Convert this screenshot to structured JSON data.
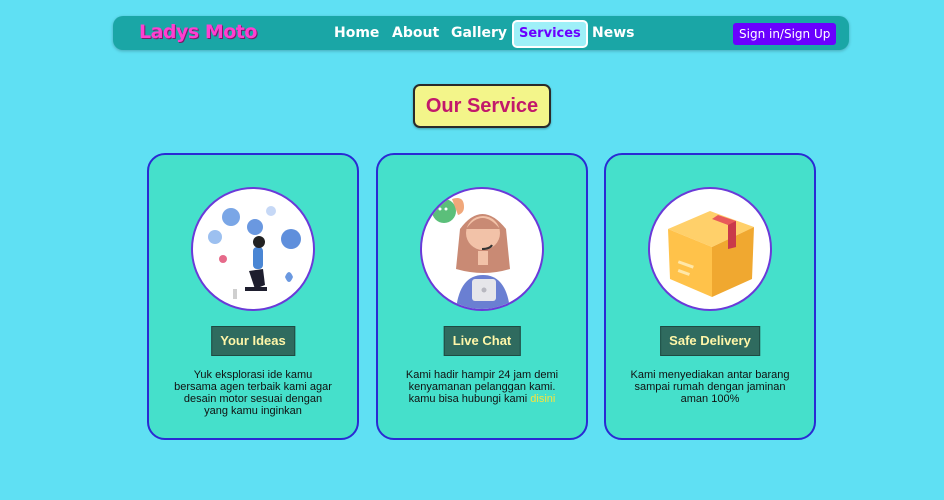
{
  "navbar": {
    "brand": "Ladys Moto",
    "links": [
      {
        "label": "Home"
      },
      {
        "label": "About"
      },
      {
        "label": "Gallery"
      },
      {
        "label": "Services"
      },
      {
        "label": "News"
      }
    ],
    "signin_label": "Sign in/Sign Up"
  },
  "section": {
    "title": "Our Service"
  },
  "cards": [
    {
      "button": "Your Ideas",
      "text": "Yuk eksplorasi ide kamu bersama agen terbaik kami agar desain motor sesuai dengan yang kamu inginkan",
      "icon": "ideas-illustration"
    },
    {
      "button": "Live Chat",
      "text_before": "Kami hadir hampir 24 jam demi kenyamanan pelanggan kami. kamu bisa hubungi kami ",
      "link": "disini",
      "icon": "live-chat-illustration"
    },
    {
      "button": "Safe Delivery",
      "text": "Kami menyediakan antar barang sampai rumah dengan jaminan aman 100%",
      "icon": "package-box-illustration"
    }
  ],
  "colors": {
    "background": "#5fe0f3",
    "navbar": "#1aa6a6",
    "brand": "#ff3fd0",
    "active_tab": "#6a00ff",
    "card": "#45e0cb",
    "card_border": "#2a2ad4",
    "title_bg": "#f3f58a",
    "title_text": "#c2186b"
  }
}
